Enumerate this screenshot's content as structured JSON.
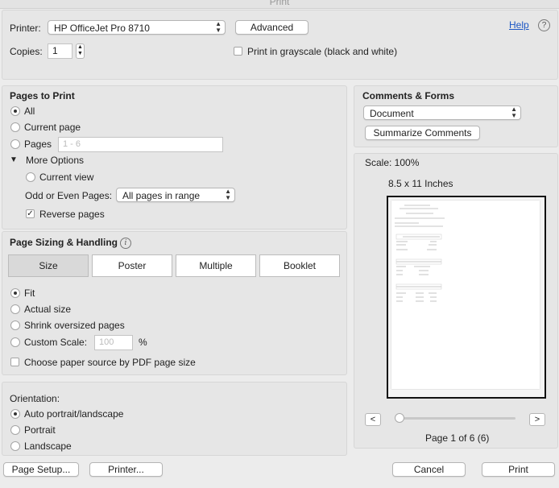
{
  "window": {
    "title": "Print"
  },
  "top": {
    "printer_label": "Printer:",
    "printer_value": "HP OfficeJet Pro 8710",
    "advanced_label": "Advanced",
    "help_label": "Help",
    "copies_label": "Copies:",
    "copies_value": "1",
    "grayscale_label": "Print in grayscale (black and white)"
  },
  "pages_to_print": {
    "title": "Pages to Print",
    "all_label": "All",
    "current_page_label": "Current page",
    "pages_label": "Pages",
    "pages_placeholder": "1 - 6",
    "more_options_label": "More Options",
    "current_view_label": "Current view",
    "odd_even_label": "Odd or Even Pages:",
    "odd_even_value": "All pages in range",
    "reverse_label": "Reverse pages",
    "reverse_checked": true
  },
  "sizing": {
    "title": "Page Sizing & Handling",
    "tabs": [
      "Size",
      "Poster",
      "Multiple",
      "Booklet"
    ],
    "fit_label": "Fit",
    "actual_size_label": "Actual size",
    "shrink_label": "Shrink oversized pages",
    "custom_scale_label": "Custom Scale:",
    "custom_scale_value": "100",
    "percent_label": "%",
    "paper_source_label": "Choose paper source by PDF page size"
  },
  "orientation": {
    "title": "Orientation:",
    "auto_label": "Auto portrait/landscape",
    "portrait_label": "Portrait",
    "landscape_label": "Landscape"
  },
  "comments_forms": {
    "title": "Comments & Forms",
    "value": "Document",
    "summarize_label": "Summarize Comments"
  },
  "preview": {
    "scale_label": "Scale: 100%",
    "paper_size": "8.5 x 11 Inches",
    "page_indicator": "Page 1 of 6 (6)",
    "prev_label": "<",
    "next_label": ">"
  },
  "footer": {
    "page_setup_label": "Page Setup...",
    "printer_label": "Printer...",
    "cancel_label": "Cancel",
    "print_label": "Print"
  }
}
